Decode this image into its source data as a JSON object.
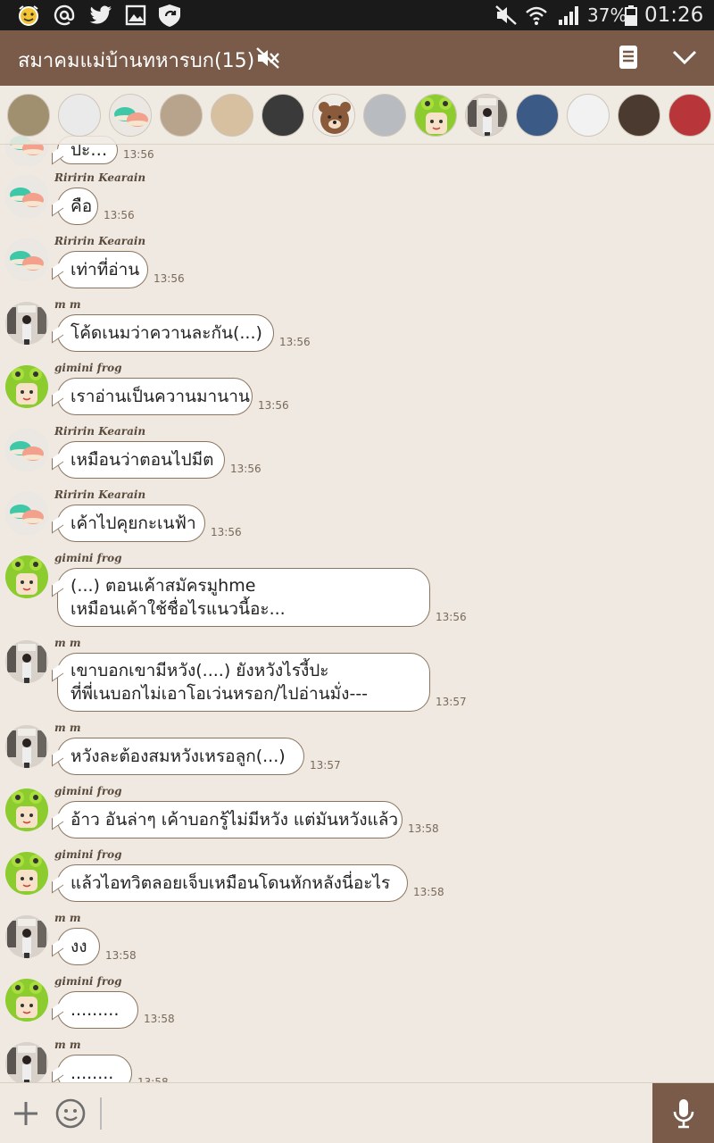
{
  "status_bar": {
    "battery_percent": "37%",
    "time": "01:26",
    "icons": [
      "alarm-clock-icon",
      "at-sign-icon",
      "twitter-icon",
      "gallery-icon",
      "shield-refresh-icon",
      "mute-icon",
      "wifi-icon",
      "signal-icon",
      "battery-icon"
    ]
  },
  "header": {
    "title": "สมาคมแม่บ้านทหารบก(15)",
    "icons": [
      "mute-icon",
      "notes-icon",
      "chevron-down-icon"
    ]
  },
  "members": {
    "count_shown": 14
  },
  "messages": [
    {
      "sender": "",
      "avatar": "macaron",
      "text": "ปะ…",
      "time": "13:56"
    },
    {
      "sender": "Riririn Kearain",
      "avatar": "macaron",
      "text": "คือ",
      "time": "13:56"
    },
    {
      "sender": "Riririn Kearain",
      "avatar": "macaron",
      "text": "เท่าที่อ่าน",
      "time": "13:56"
    },
    {
      "sender": "m m",
      "avatar": "girl",
      "text": "โค้ดเนมว่าควานละกัน(...)",
      "time": "13:56"
    },
    {
      "sender": "gimini frog",
      "avatar": "frog",
      "text": "เราอ่านเป็นควานมานาน",
      "time": "13:56"
    },
    {
      "sender": "Riririn Kearain",
      "avatar": "macaron",
      "text": "เหมือนว่าตอนไปมีต",
      "time": "13:56"
    },
    {
      "sender": "Riririn Kearain",
      "avatar": "macaron",
      "text": "เค้าไปคุยกะเนฟ้า",
      "time": "13:56"
    },
    {
      "sender": "gimini frog",
      "avatar": "frog",
      "line1": "(...) ตอนเค้าสมัครมูhme",
      "line2": "เหมือนเค้าใช้ชื่อไรแนวนี้อะ...",
      "time": "13:56"
    },
    {
      "sender": "m m",
      "avatar": "girl",
      "line1": "เขาบอกเขามีหวัง(....) ยังหวังไรงี้ปะ",
      "line2": "ที่พี่เนบอกไม่เอาโอเว่นหรอก/ไปอ่านมั่ง---",
      "time": "13:57"
    },
    {
      "sender": "m m",
      "avatar": "girl",
      "text": "หวังละต้องสมหวังเหรอลูก(...)",
      "time": "13:57"
    },
    {
      "sender": "gimini frog",
      "avatar": "frog",
      "text": "อ้าว อันล่าๆ เค้าบอกรู้ไม่มีหวัง แต่มันหวังแล้ว",
      "time": "13:58"
    },
    {
      "sender": "gimini frog",
      "avatar": "frog",
      "text": "แล้วไอทวิตลอยเจ็บเหมือนโดนหักหลังนี่อะไร",
      "time": "13:58"
    },
    {
      "sender": "m m",
      "avatar": "girl",
      "text": "งง",
      "time": "13:58"
    },
    {
      "sender": "gimini frog",
      "avatar": "frog",
      "text": ".........",
      "time": "13:58"
    },
    {
      "sender": "m m",
      "avatar": "girl",
      "text": "........",
      "time": "13:58"
    }
  ],
  "input": {
    "placeholder": "",
    "icons": [
      "plus-icon",
      "emoji-icon",
      "microphone-icon"
    ]
  },
  "colors": {
    "header_bg": "#7a5a49",
    "chat_bg": "#efe9e1",
    "bubble_border": "#8b7560",
    "status_bg": "#1a1a1a"
  }
}
